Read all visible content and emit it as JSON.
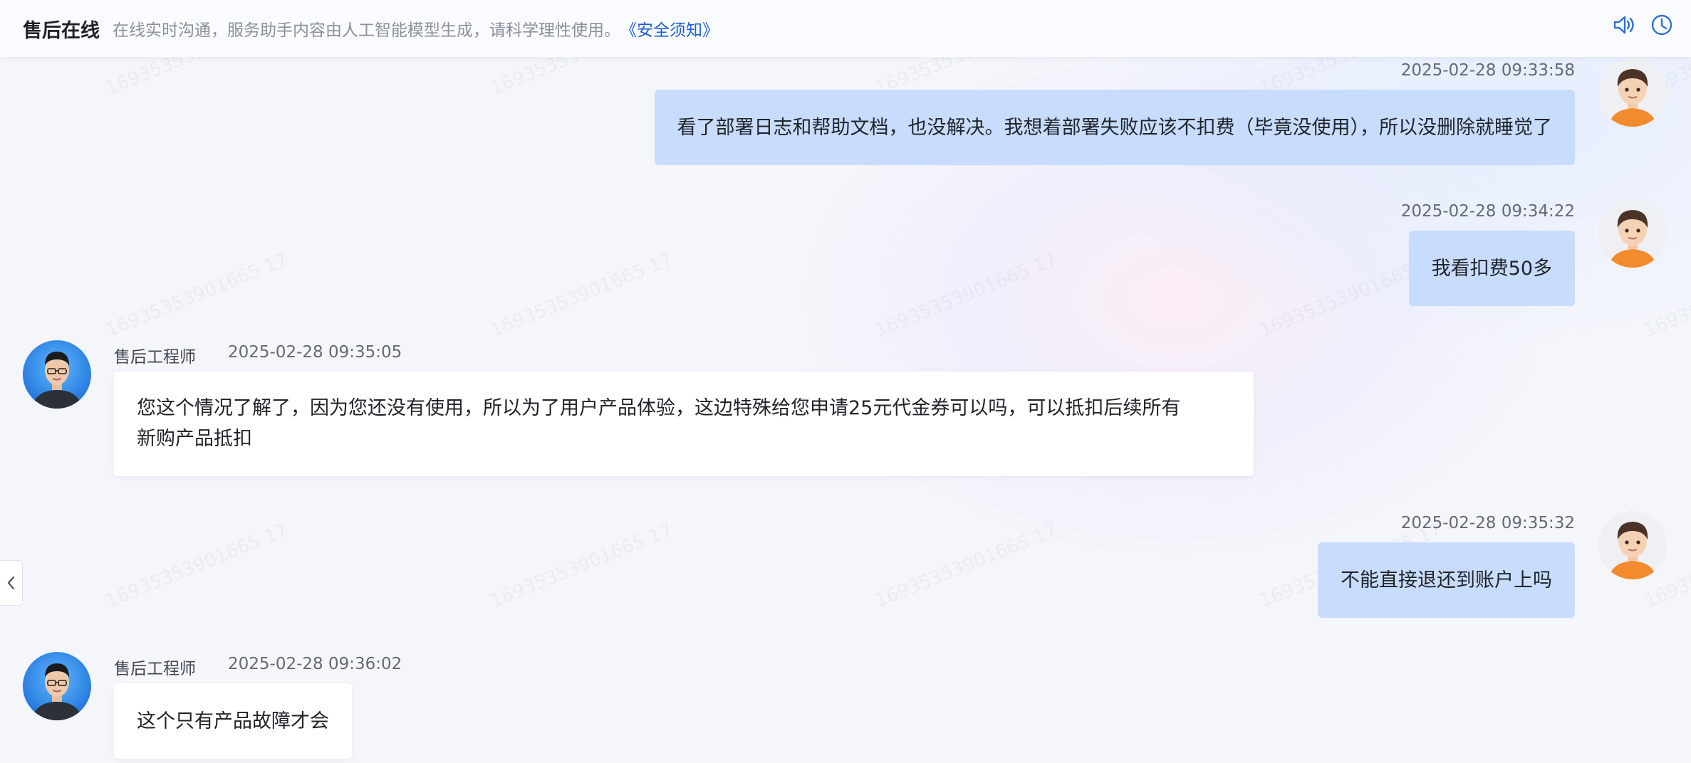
{
  "header": {
    "title": "售后在线",
    "notice": "在线实时沟通，服务助手内容由人工智能模型生成，请科学理性使用。",
    "link": "《安全须知》",
    "icons": [
      "speaker-icon",
      "history-clock-icon"
    ]
  },
  "watermark": "16935353901665 17",
  "messages": [
    {
      "role": "user",
      "time": "2025-02-28 09:33:58",
      "text": "看了部署日志和帮助文档，也没解决。我想着部署失败应该不扣费（毕竟没使用），所以没删除就睡觉了"
    },
    {
      "role": "user",
      "time": "2025-02-28 09:34:22",
      "text": "我看扣费50多"
    },
    {
      "role": "agent",
      "sender": "售后工程师",
      "time": "2025-02-28 09:35:05",
      "text_line1": "您这个情况了解了，因为您还没有使用，所以为了用户产品体验，这边特殊给您申请25元代金券可以吗，可以抵扣后续所有",
      "text_line2": "新购产品抵扣"
    },
    {
      "role": "user",
      "time": "2025-02-28 09:35:32",
      "text": "不能直接退还到账户上吗"
    },
    {
      "role": "agent",
      "sender": "售后工程师",
      "time": "2025-02-28 09:36:02",
      "text": "这个只有产品故障才会"
    }
  ],
  "colors": {
    "user_bubble": "#c8dcfd",
    "agent_bubble": "#ffffff",
    "link": "#1f5fcf",
    "icon_blue": "#2b6fd6"
  }
}
